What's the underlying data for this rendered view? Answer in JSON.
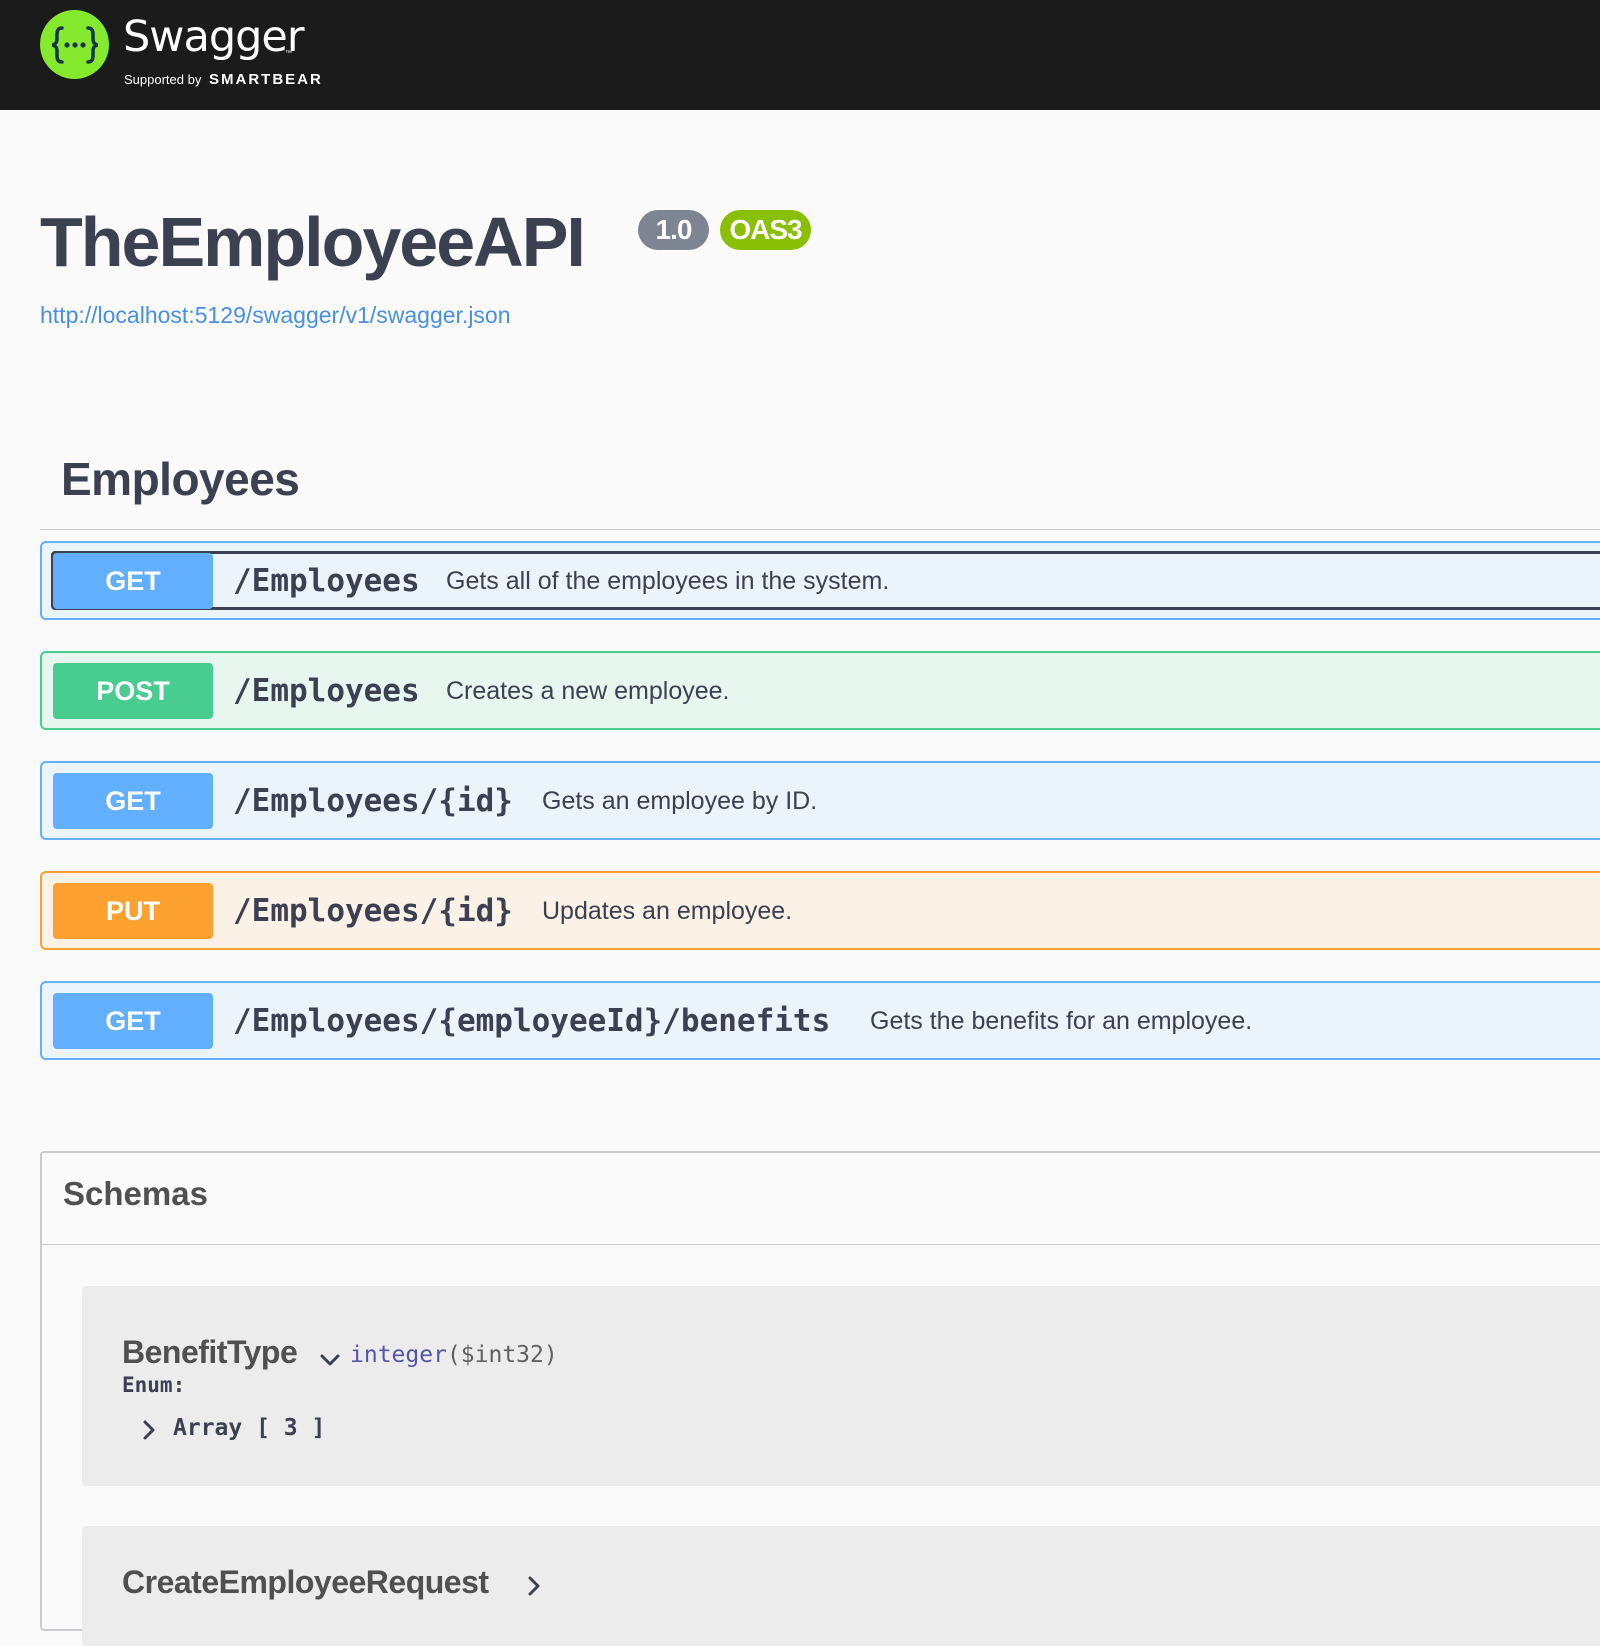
{
  "topbar": {
    "brand_name": "Swagger",
    "brand_tm": "™",
    "supported_by": "Supported by",
    "company": "SMARTBEAR",
    "logo_icon": "swagger-braces-icon",
    "background_color": "#1b1b1b",
    "logo_color": "#85ea2d"
  },
  "info": {
    "title": "TheEmployeeAPI",
    "version": "1.0",
    "oas_badge": "OAS3",
    "spec_url": "http://localhost:5129/swagger/v1/swagger.json"
  },
  "tag": {
    "name": "Employees"
  },
  "operations": [
    {
      "method": "GET",
      "path": "/Employees",
      "summary": "Gets all of the employees in the system.",
      "focused": true
    },
    {
      "method": "POST",
      "path": "/Employees",
      "summary": "Creates a new employee.",
      "focused": false
    },
    {
      "method": "GET",
      "path": "/Employees/{id}",
      "summary": "Gets an employee by ID.",
      "focused": false
    },
    {
      "method": "PUT",
      "path": "/Employees/{id}",
      "summary": "Updates an employee.",
      "focused": false
    },
    {
      "method": "GET",
      "path": "/Employees/{employeeId}/benefits",
      "summary": "Gets the benefits for an employee.",
      "focused": false
    }
  ],
  "method_colors": {
    "GET": "#61affe",
    "POST": "#49cc90",
    "PUT": "#fca130"
  },
  "schemas": {
    "title": "Schemas",
    "models": [
      {
        "name": "BenefitType",
        "expanded": true,
        "type": "integer",
        "format": "($int32)",
        "enum_label": "Enum:",
        "enum_summary": "Array [ 3 ]"
      },
      {
        "name": "CreateEmployeeRequest",
        "expanded": false
      }
    ]
  }
}
